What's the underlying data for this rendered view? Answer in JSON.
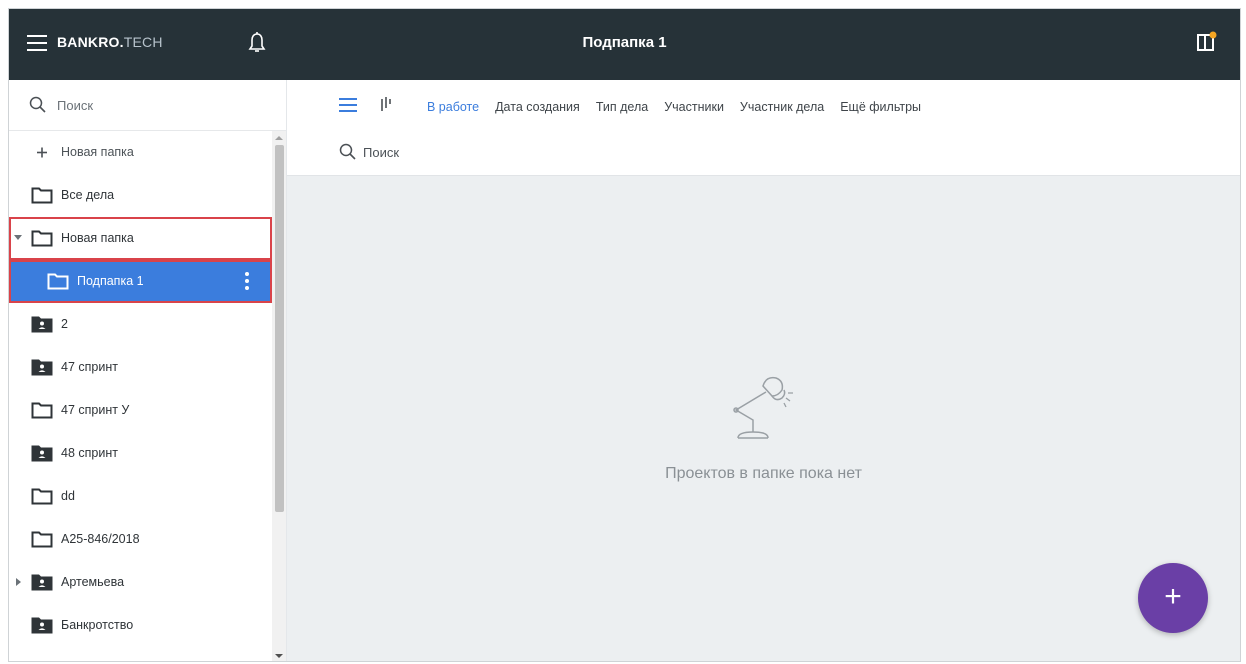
{
  "header": {
    "logo_main": "BANKRO.",
    "logo_suffix": "TECH",
    "title": "Подпапка 1"
  },
  "sidebar": {
    "search_placeholder": "Поиск",
    "items": [
      {
        "label": "Новая папка",
        "icon": "plus-icon"
      },
      {
        "label": "Все дела",
        "icon": "folder-outline-icon"
      },
      {
        "label": "Новая папка",
        "icon": "folder-outline-icon",
        "expanded": true
      },
      {
        "label": "Подпапка 1",
        "icon": "folder-outline-icon",
        "selected": true
      },
      {
        "label": "2",
        "icon": "shared-folder-icon"
      },
      {
        "label": "47 спринт",
        "icon": "shared-folder-icon"
      },
      {
        "label": "47 спринт У",
        "icon": "folder-outline-icon"
      },
      {
        "label": "48 спринт",
        "icon": "shared-folder-icon"
      },
      {
        "label": "dd",
        "icon": "folder-outline-icon"
      },
      {
        "label": "А25-846/2018",
        "icon": "folder-outline-icon"
      },
      {
        "label": "Артемьева",
        "icon": "shared-folder-icon",
        "collapsed": true
      },
      {
        "label": "Банкротство",
        "icon": "shared-folder-icon"
      }
    ]
  },
  "main": {
    "filters": [
      {
        "label": "В работе",
        "active": true
      },
      {
        "label": "Дата создания"
      },
      {
        "label": "Тип дела"
      },
      {
        "label": "Участники"
      },
      {
        "label": "Участник дела"
      },
      {
        "label": "Ещё фильтры"
      }
    ],
    "search_placeholder": "Поиск",
    "empty_message": "Проектов в папке пока нет",
    "fab_label": "+"
  },
  "colors": {
    "topbar": "#263238",
    "accent": "#3b7ddd",
    "fab": "#6a3fa6",
    "highlight_border": "#d9434a"
  }
}
